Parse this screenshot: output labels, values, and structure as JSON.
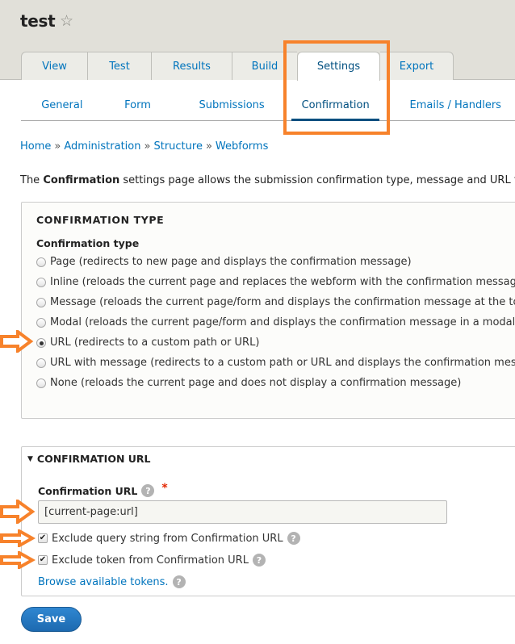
{
  "header": {
    "title": "test",
    "favorite_icon": "star-outline-icon"
  },
  "primary_tabs": [
    {
      "label": "View",
      "active": false
    },
    {
      "label": "Test",
      "active": false
    },
    {
      "label": "Results",
      "active": false
    },
    {
      "label": "Build",
      "active": false
    },
    {
      "label": "Settings",
      "active": true
    },
    {
      "label": "Export",
      "active": false
    }
  ],
  "secondary_tabs": [
    {
      "label": "General",
      "active": false
    },
    {
      "label": "Form",
      "active": false
    },
    {
      "label": "Submissions",
      "active": false
    },
    {
      "label": "Confirmation",
      "active": true
    },
    {
      "label": "Emails / Handlers",
      "active": false
    }
  ],
  "breadcrumb": {
    "items": [
      "Home",
      "Administration",
      "Structure",
      "Webforms"
    ],
    "separator": "»"
  },
  "description": {
    "prefix": "The ",
    "bold": "Confirmation",
    "suffix": " settings page allows the submission confirmation type, message and URL to be"
  },
  "confirmation_type": {
    "legend": "CONFIRMATION TYPE",
    "label": "Confirmation type",
    "options": [
      {
        "label": "Page (redirects to new page and displays the confirmation message)",
        "checked": false
      },
      {
        "label": "Inline (reloads the current page and replaces the webform with the confirmation message)",
        "checked": false
      },
      {
        "label": "Message (reloads the current page/form and displays the confirmation message at the top of the page)",
        "checked": false
      },
      {
        "label": "Modal (reloads the current page/form and displays the confirmation message in a modal dialog)",
        "checked": false
      },
      {
        "label": "URL (redirects to a custom path or URL)",
        "checked": true
      },
      {
        "label": "URL with message (redirects to a custom path or URL and displays the confirmation message)",
        "checked": false
      },
      {
        "label": "None (reloads the current page and does not display a confirmation message)",
        "checked": false
      }
    ]
  },
  "confirmation_url": {
    "legend": "CONFIRMATION URL",
    "expanded": true,
    "field_label": "Confirmation URL",
    "required_mark": "*",
    "help_glyph": "?",
    "value": "[current-page:url]",
    "checkboxes": [
      {
        "label": "Exclude query string from Confirmation URL",
        "checked": true
      },
      {
        "label": "Exclude token from Confirmation URL",
        "checked": true
      }
    ],
    "browse_link": "Browse available tokens."
  },
  "actions": {
    "save_label": "Save"
  },
  "annotations": {
    "highlight_color": "#f7822b"
  },
  "colors": {
    "link": "#0074bd",
    "active_tab": "#004f80",
    "button": "#1d6ab0",
    "required": "#e32700"
  }
}
